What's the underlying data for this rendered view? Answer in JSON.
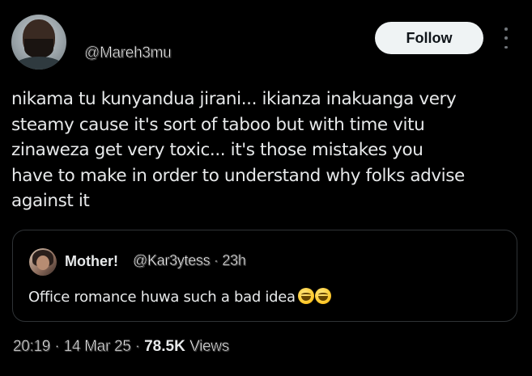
{
  "header": {
    "handle": "@Mareh3mu",
    "follow_label": "Follow",
    "more_icon": "more-vertical-icon"
  },
  "tweet": {
    "text": "nikama tu kunyandua jirani... ikianza inakuanga very\nsteamy cause it's sort of taboo but with time vitu\nzinaweza get very toxic... it's those mistakes you\nhave to make in order to understand why folks advise\nagainst it"
  },
  "quote": {
    "name": "Mother!",
    "handle": "@Kar3ytess",
    "separator": "·",
    "time": "23h",
    "text": "Office romance huwa such a bad idea",
    "emojis": [
      "grinning-squinting-face",
      "grinning-squinting-face"
    ]
  },
  "meta": {
    "time": "20:19",
    "separator": "·",
    "date": "14 Mar 25",
    "views_count": "78.5K",
    "views_label": "Views"
  },
  "colors": {
    "background": "#000000",
    "text": "#e7e9ea",
    "muted": "#71767b",
    "border": "#2f3336",
    "button_bg": "#eff3f4",
    "button_text": "#0f1419"
  }
}
